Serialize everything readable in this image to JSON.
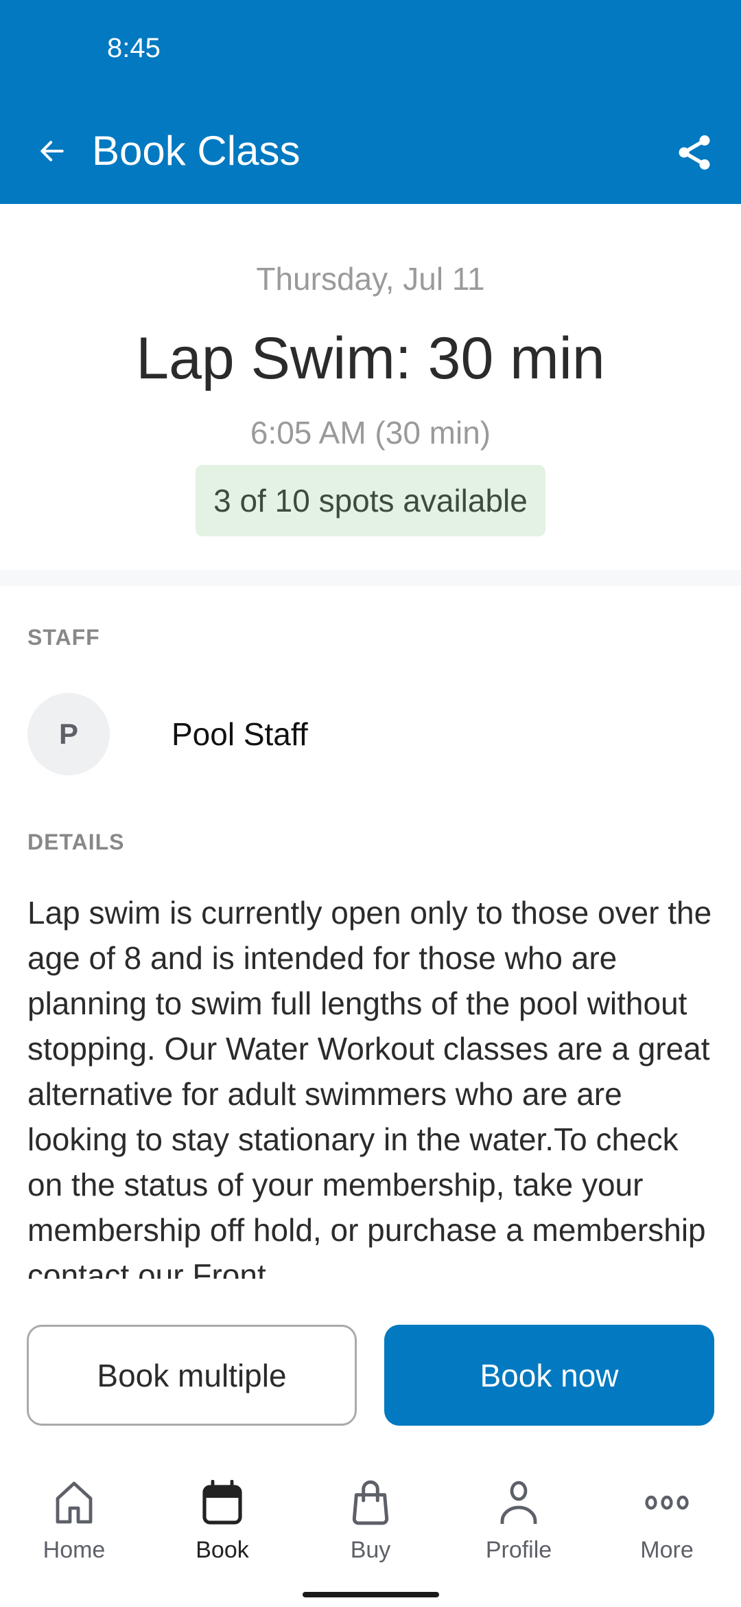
{
  "status_bar": {
    "time": "8:45"
  },
  "header": {
    "title": "Book Class",
    "back_icon": "arrow-left-icon",
    "share_icon": "share-icon",
    "background_color": "#0279c0"
  },
  "class": {
    "date": "Thursday, Jul 11",
    "title": "Lap Swim: 30 min",
    "time": "6:05 AM (30 min)",
    "spots_text": "3 of 10 spots available",
    "spots_available": 3,
    "spots_total": 10,
    "badge_color": "#e3f2e3"
  },
  "staff": {
    "section_label": "STAFF",
    "members": [
      {
        "initial": "P",
        "name": "Pool Staff"
      }
    ]
  },
  "details": {
    "section_label": "DETAILS",
    "text": "Lap swim is currently open only to those over the age of 8 and is intended for those who are planning to swim full lengths of the pool without stopping. Our Water Workout classes are a great alternative for adult swimmers who are are looking to stay stationary in the water.To check on the status of your membership, take your membership off hold, or purchase a membership contact our Front"
  },
  "actions": {
    "book_multiple_label": "Book multiple",
    "book_now_label": "Book now",
    "primary_color": "#0279c0"
  },
  "bottom_nav": {
    "items": [
      {
        "label": "Home",
        "icon": "home-icon",
        "active": false
      },
      {
        "label": "Book",
        "icon": "calendar-icon",
        "active": true
      },
      {
        "label": "Buy",
        "icon": "shopping-bag-icon",
        "active": false
      },
      {
        "label": "Profile",
        "icon": "person-icon",
        "active": false
      },
      {
        "label": "More",
        "icon": "more-horizontal-icon",
        "active": false
      }
    ]
  }
}
